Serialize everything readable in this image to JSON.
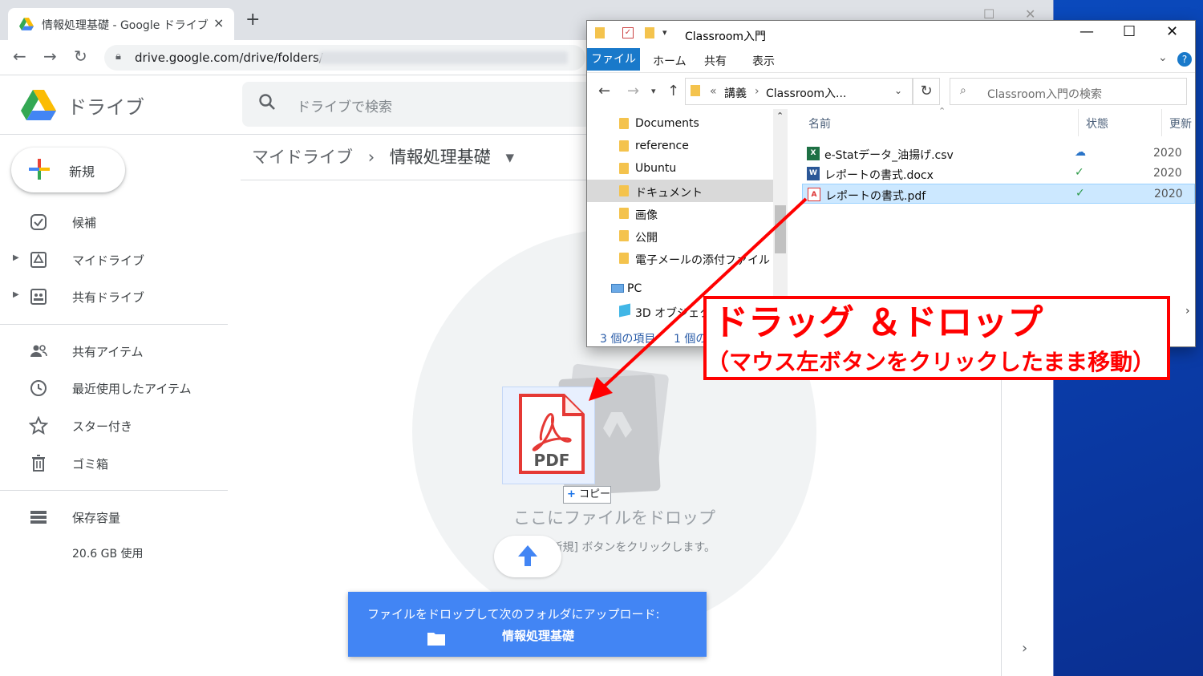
{
  "browser": {
    "tab_title": "情報処理基礎 - Google ドライブ",
    "tab_close": "×",
    "new_tab": "+",
    "url": "drive.google.com/drive/folders/",
    "back": "←",
    "forward": "→",
    "reload": "↻"
  },
  "drive": {
    "app_name": "ドライブ",
    "search_placeholder": "ドライブで検索",
    "new_button": "新規",
    "nav": {
      "priority": "候補",
      "my_drive": "マイドライブ",
      "shared_drives": "共有ドライブ",
      "shared_with_me": "共有アイテム",
      "recent": "最近使用したアイテム",
      "starred": "スター付き",
      "trash": "ゴミ箱",
      "storage": "保存容量",
      "storage_used": "20.6 GB 使用"
    },
    "breadcrumb": {
      "root": "マイドライブ",
      "sep": "›",
      "current": "情報処理基礎",
      "dropdown": "▾"
    },
    "drop_zone": {
      "copy_badge_plus": "+",
      "copy_badge": "コピー",
      "pdf_label": "PDF",
      "title": "ここにファイルをドロップ",
      "subtitle": "[新規] ボタンをクリックします。"
    },
    "upload_banner": {
      "line1": "ファイルをドロップして次のフォルダにアップロード:",
      "folder": "情報処理基礎"
    },
    "expand": "›"
  },
  "explorer": {
    "title": "Classroom入門",
    "ribbon": {
      "file": "ファイル",
      "home": "ホーム",
      "share": "共有",
      "view": "表示",
      "help": "?"
    },
    "address": {
      "prefix": "«",
      "part1": "講義",
      "sep": "›",
      "part2": "Classroom入..."
    },
    "search_placeholder": "Classroom入門の検索",
    "tree": [
      {
        "label": "Documents"
      },
      {
        "label": "reference"
      },
      {
        "label": "Ubuntu"
      },
      {
        "label": "ドキュメント"
      },
      {
        "label": "画像"
      },
      {
        "label": "公開"
      },
      {
        "label": "電子メールの添付ファイル"
      }
    ],
    "tree_pc": "PC",
    "tree_3d": "3D オブジェクト",
    "columns": {
      "name": "名前",
      "status": "状態",
      "date": "更新"
    },
    "files": [
      {
        "name": "e-Statデータ_油揚げ.csv",
        "status": "cloud",
        "date": "2020"
      },
      {
        "name": "レポートの書式.docx",
        "status": "check",
        "date": "2020"
      },
      {
        "name": "レポートの書式.pdf",
        "status": "check",
        "date": "2020"
      }
    ],
    "status_bar": {
      "count": "3 個の項目",
      "selected": "1 個の"
    }
  },
  "annotation": {
    "title": "ドラッグ ＆ドロップ",
    "subtitle": "（マウス左ボタンをクリックしたまま移動）",
    "color": "#ff0000"
  },
  "colors": {
    "drive_blue": "#4285f4",
    "explorer_accent": "#1979ca",
    "desktop": "#0a4fc0"
  }
}
